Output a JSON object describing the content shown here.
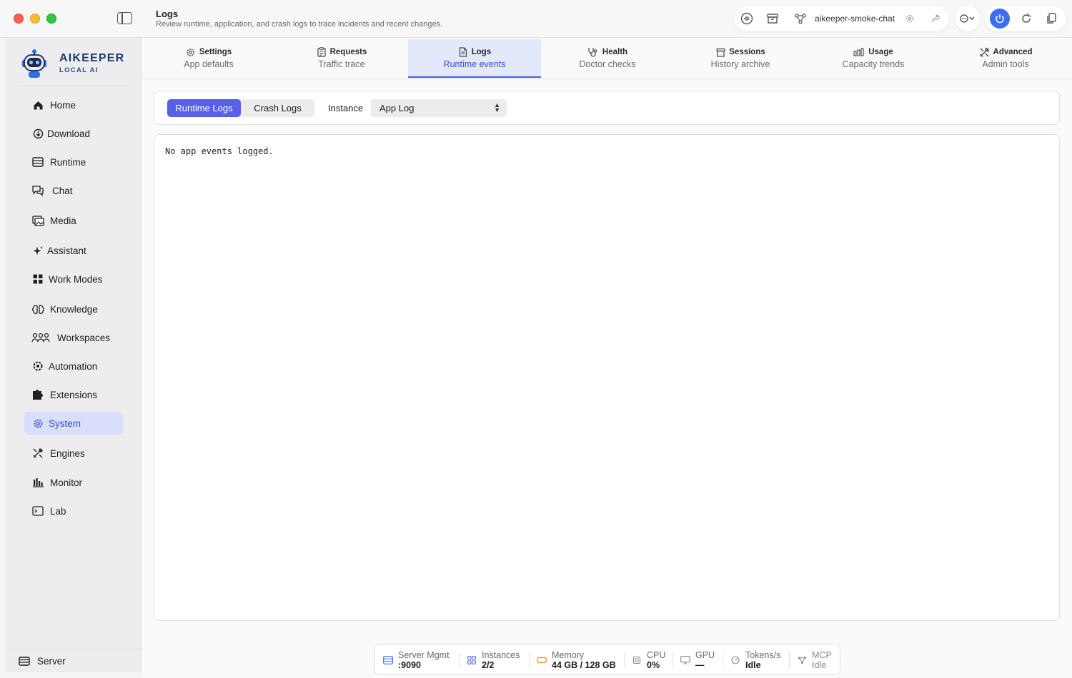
{
  "titlebar": {
    "title": "Logs",
    "subtitle": "Review runtime, application, and crash logs to trace incidents and recent changes.",
    "instance_name": "aikeeper-smoke-chat"
  },
  "brand": {
    "name": "AIKEEPER",
    "sub": "LOCAL AI"
  },
  "sidebar": {
    "items": [
      {
        "label": "Home",
        "icon": "home-icon"
      },
      {
        "label": "Download",
        "icon": "download-icon"
      },
      {
        "label": "Runtime",
        "icon": "runtime-icon"
      },
      {
        "label": "Chat",
        "icon": "chat-icon"
      },
      {
        "label": "Media",
        "icon": "media-icon"
      },
      {
        "label": "Assistant",
        "icon": "sparkle-icon"
      },
      {
        "label": "Work Modes",
        "icon": "grid-icon"
      },
      {
        "label": "Knowledge",
        "icon": "brain-icon"
      },
      {
        "label": "Workspaces",
        "icon": "people-icon"
      },
      {
        "label": "Automation",
        "icon": "automation-icon"
      },
      {
        "label": "Extensions",
        "icon": "puzzle-icon"
      },
      {
        "label": "System",
        "icon": "gear-icon"
      },
      {
        "label": "Engines",
        "icon": "tools-icon"
      },
      {
        "label": "Monitor",
        "icon": "bars-icon"
      },
      {
        "label": "Lab",
        "icon": "terminal-icon"
      }
    ],
    "active": "System",
    "footer_label": "Server"
  },
  "tabs": [
    {
      "label": "Settings",
      "sub": "App defaults",
      "icon": "gear-icon"
    },
    {
      "label": "Requests",
      "sub": "Traffic trace",
      "icon": "clipboard-icon"
    },
    {
      "label": "Logs",
      "sub": "Runtime events",
      "icon": "document-icon"
    },
    {
      "label": "Health",
      "sub": "Doctor checks",
      "icon": "stethoscope-icon"
    },
    {
      "label": "Sessions",
      "sub": "History archive",
      "icon": "archive-icon"
    },
    {
      "label": "Usage",
      "sub": "Capacity trends",
      "icon": "chart-icon"
    },
    {
      "label": "Advanced",
      "sub": "Admin tools",
      "icon": "tools-icon"
    }
  ],
  "controls": {
    "segments": [
      "Runtime Logs",
      "Crash Logs"
    ],
    "instance_label": "Instance",
    "instance_value": "App Log"
  },
  "log": {
    "text": "No app events logged."
  },
  "status": [
    {
      "label": "Server Mgmt",
      "value": ":9090",
      "icon": "server-icon"
    },
    {
      "label": "Instances",
      "value": "2/2",
      "icon": "grid-icon"
    },
    {
      "label": "Memory",
      "value": "44 GB / 128 GB",
      "icon": "memory-icon"
    },
    {
      "label": "CPU",
      "value": "0%",
      "icon": "cpu-icon"
    },
    {
      "label": "GPU",
      "value": "—",
      "icon": "monitor-icon"
    },
    {
      "label": "Tokens/s",
      "value": "Idle",
      "icon": "gauge-icon"
    },
    {
      "label": "MCP",
      "value": "Idle",
      "icon": "nodes-icon"
    }
  ],
  "colors": {
    "accent": "#5860e8",
    "active_nav_bg": "#d9defa",
    "power": "#3b6ef6",
    "memory_icon": "#f08a24"
  }
}
